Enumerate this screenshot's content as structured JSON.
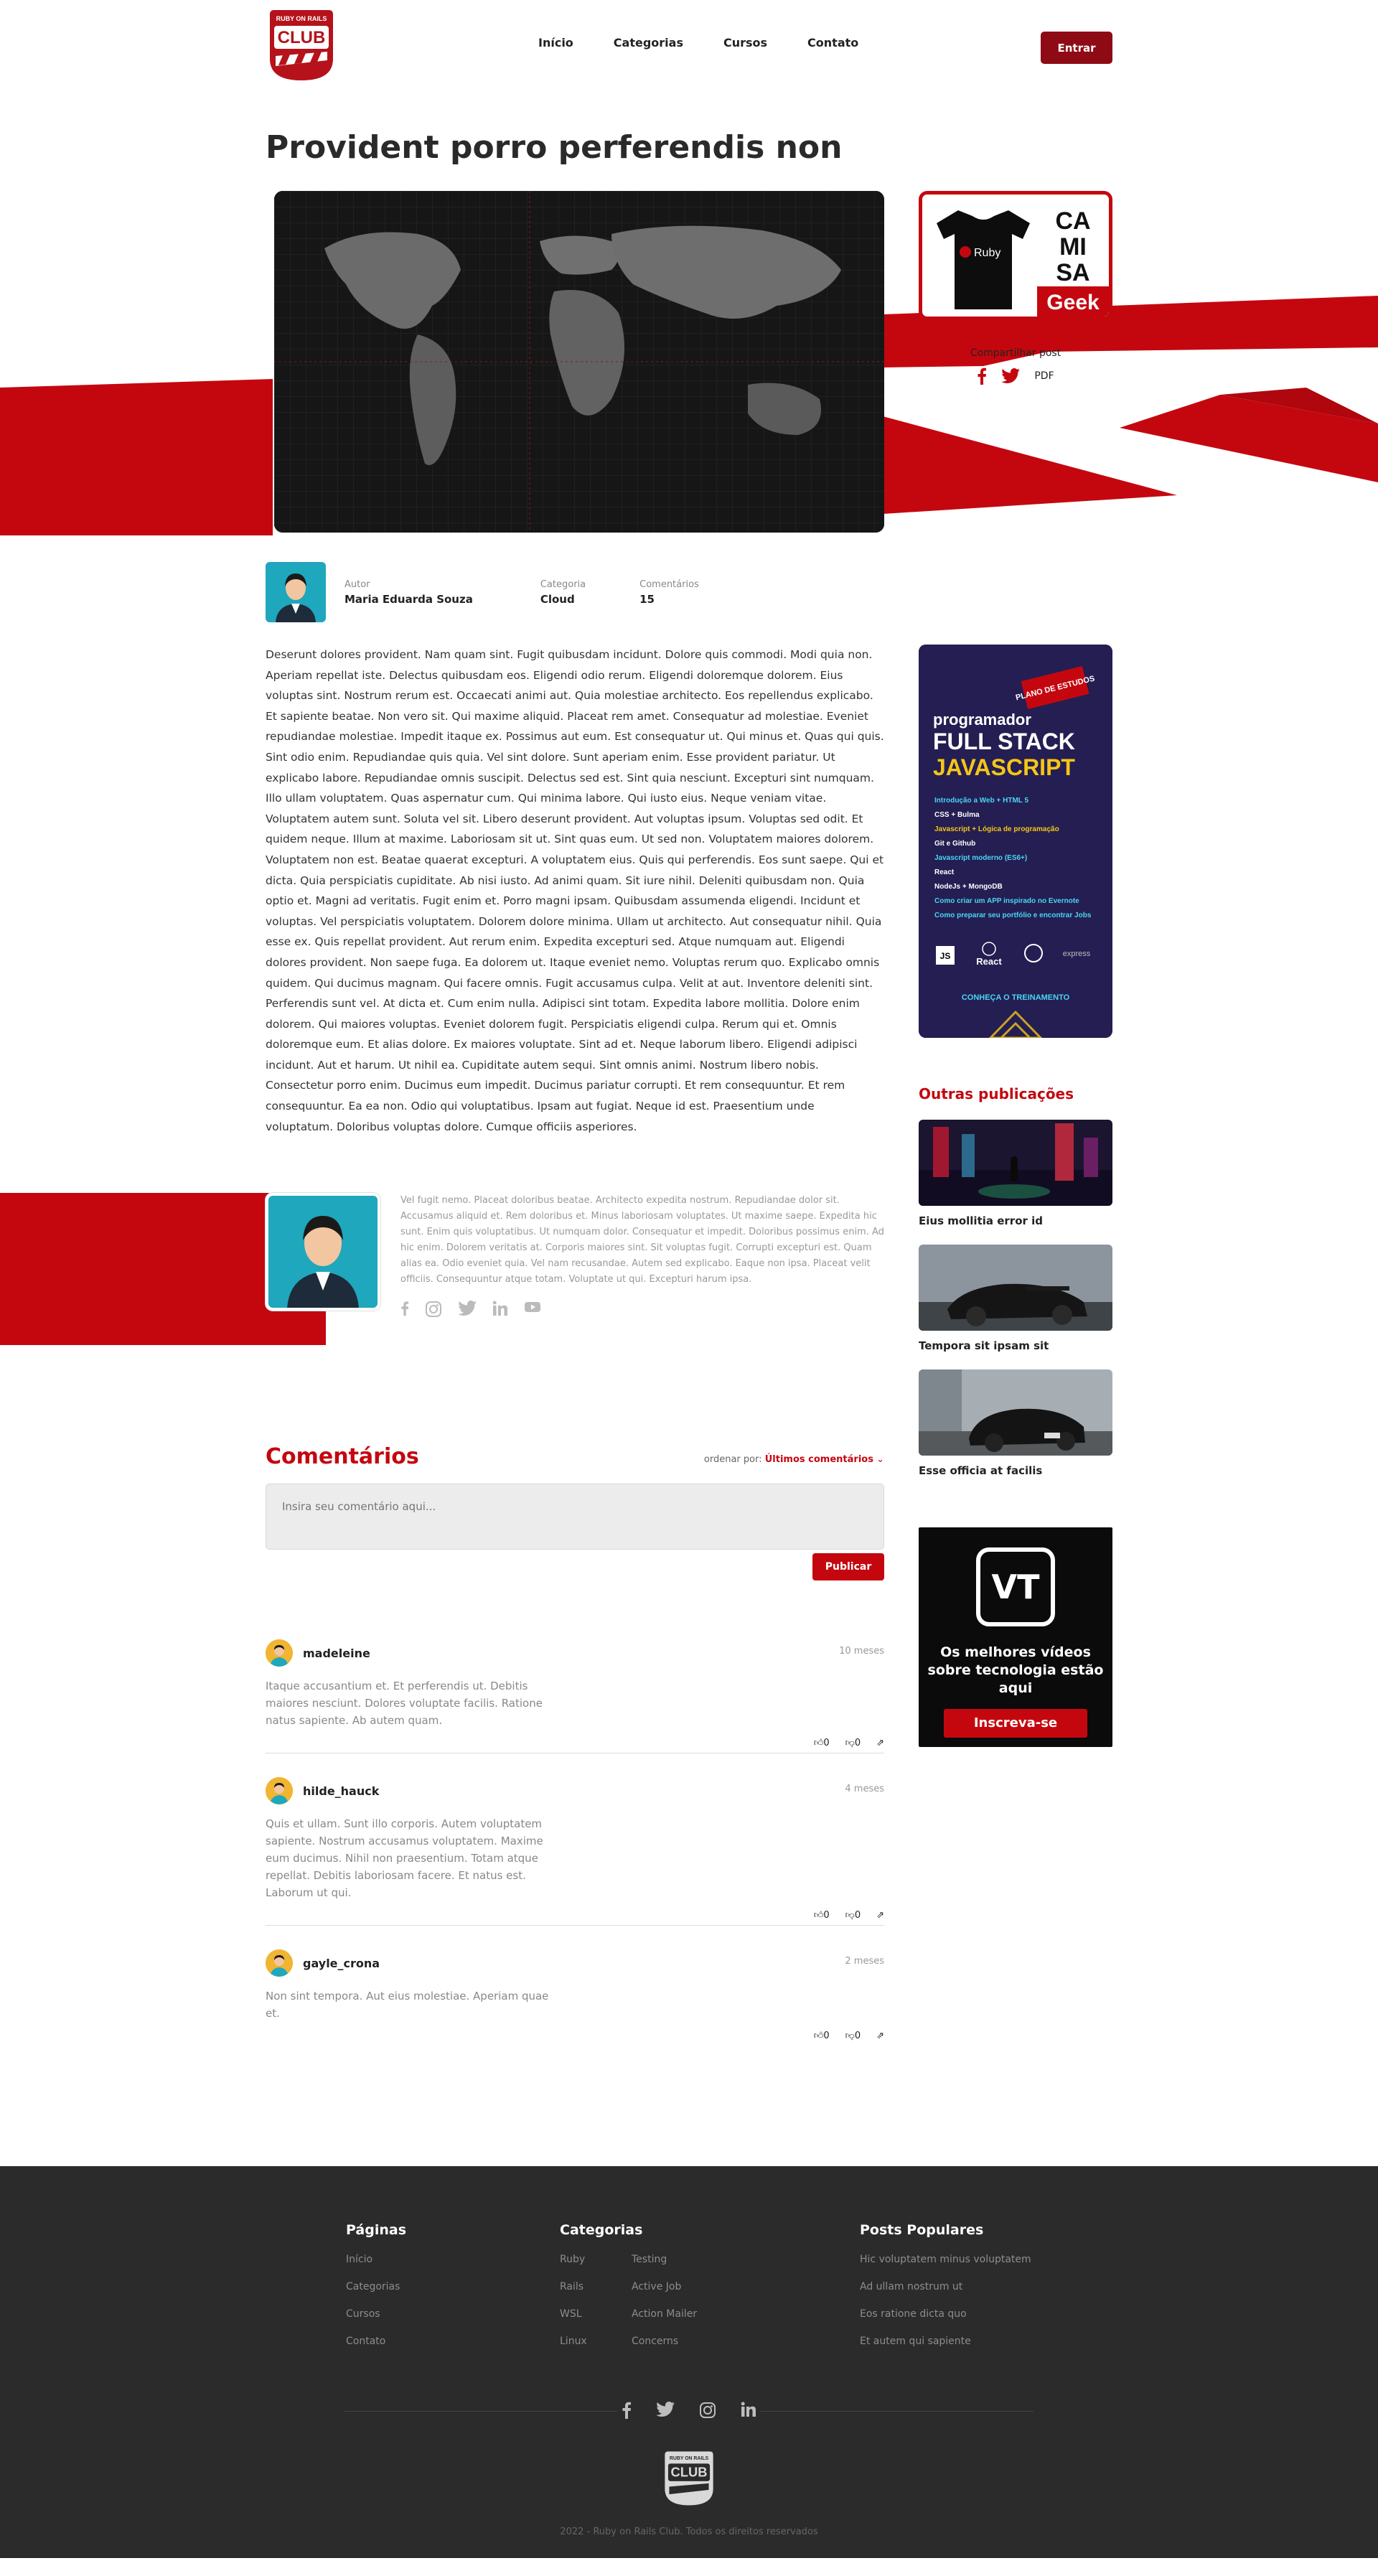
{
  "header": {
    "logo_top": "RUBY ON RAILS",
    "logo_main": "CLUB",
    "nav": [
      "Início",
      "Categorias",
      "Cursos",
      "Contato"
    ],
    "login_label": "Entrar"
  },
  "post": {
    "title": "Provident porro perferendis non",
    "author_label": "Autor",
    "author": "Maria Eduarda Souza",
    "category_label": "Categoria",
    "category": "Cloud",
    "comments_label": "Comentários",
    "comments_count": "15",
    "body": "Deserunt dolores provident. Nam quam sint. Fugit quibusdam incidunt. Dolore quis commodi. Modi quia non. Aperiam repellat iste. Delectus quibusdam eos. Eligendi odio rerum. Eligendi doloremque dolorem. Eius voluptas sint. Nostrum rerum est. Occaecati animi aut. Quia molestiae architecto. Eos repellendus explicabo. Et sapiente beatae. Non vero sit. Qui maxime aliquid. Placeat rem amet. Consequatur ad molestiae. Eveniet repudiandae molestiae. Impedit itaque ex. Possimus aut eum. Est consequatur ut. Qui minus et. Quas qui quis. Sint odio enim. Repudiandae quis quia. Vel sint dolore. Sunt aperiam enim. Esse provident pariatur. Ut explicabo labore. Repudiandae omnis suscipit. Delectus sed est. Sint quia nesciunt. Excepturi sint numquam. Illo ullam voluptatem. Quas aspernatur cum. Qui minima labore. Qui iusto eius. Neque veniam vitae. Voluptatem autem sunt. Soluta vel sit. Libero deserunt provident. Aut voluptas ipsum. Voluptas sed odit. Et quidem neque. Illum at maxime. Laboriosam sit ut. Sint quas eum. Ut sed non. Voluptatem maiores dolorem. Voluptatem non est. Beatae quaerat excepturi. A voluptatem eius. Quis qui perferendis. Eos sunt saepe. Qui et dicta. Quia perspiciatis cupiditate. Ab nisi iusto. Ad animi quam. Sit iure nihil. Deleniti quibusdam non. Quia optio et. Magni ad veritatis. Fugit enim et. Porro magni ipsam. Quibusdam assumenda eligendi. Incidunt et voluptas. Vel perspiciatis voluptatem. Dolorem dolore minima. Ullam ut architecto. Aut consequatur nihil. Quia esse ex. Quis repellat provident. Aut rerum enim. Expedita excepturi sed. Atque numquam aut. Eligendi dolores provident. Non saepe fuga. Ea dolorem ut. Itaque eveniet nemo. Voluptas rerum quo. Explicabo omnis quidem. Qui ducimus magnam. Qui facere omnis. Fugit accusamus culpa. Velit at aut. Inventore deleniti sint. Perferendis sunt vel. At dicta et. Cum enim nulla. Adipisci sint totam. Expedita labore mollitia. Dolore enim dolorem. Qui maiores voluptas. Eveniet dolorem fugit. Perspiciatis eligendi culpa. Rerum qui et. Omnis doloremque eum. Et alias dolore. Ex maiores voluptate. Sint ad et. Neque laborum libero. Eligendi adipisci incidunt. Aut et harum. Ut nihil ea. Cupiditate autem sequi. Sint omnis animi. Nostrum libero nobis. Consectetur porro enim. Ducimus eum impedit. Ducimus pariatur corrupti. Et rem consequuntur. Et rem consequuntur. Ea ea non. Odio qui voluptatibus. Ipsam aut fugiat. Neque id est. Praesentium unde voluptatum. Doloribus voluptas dolore. Cumque officiis asperiores."
  },
  "share": {
    "title": "Compartilhar post",
    "pdf": "PDF"
  },
  "ads": {
    "shirt_word1": "CA",
    "shirt_word2": "MI",
    "shirt_word3": "SA",
    "shirt_word4": "Geek",
    "shirt_brand": "Ruby",
    "js_badge": "PLANO DE ESTUDOS",
    "js_line1": "programador",
    "js_line2": "FULL STACK",
    "js_line3": "JAVASCRIPT",
    "js_items": [
      "Introdução a Web + HTML 5",
      "CSS + Bulma",
      "Javascript + Lógica de programação",
      "Git e Github",
      "Javascript moderno (ES6+)",
      "React",
      "NodeJs + MongoDB",
      "Como criar um APP inspirado no Evernote",
      "Como preparar seu portfólio e encontrar Jobs"
    ],
    "js_logos": [
      "JS",
      "React",
      "express"
    ],
    "js_cta": "CONHEÇA O TREINAMENTO",
    "vt_logo": "VT",
    "vt_text": "Os melhores vídeos sobre tecnologia estão aqui",
    "vt_cta": "Inscreva-se"
  },
  "sidebar": {
    "other_title": "Outras publicações",
    "items": [
      {
        "title": "Eius mollitia error id"
      },
      {
        "title": "Tempora sit ipsam sit"
      },
      {
        "title": "Esse officia at facilis"
      }
    ]
  },
  "bio": {
    "text": "Vel fugit nemo. Placeat doloribus beatae. Architecto expedita nostrum. Repudiandae dolor sit. Accusamus aliquid et. Rem doloribus et. Minus laboriosam voluptates. Ut maxime saepe. Expedita hic sunt. Enim quis voluptatibus. Ut numquam dolor. Consequatur et impedit. Doloribus possimus enim. Ad hic enim. Dolorem veritatis at. Corporis maiores sint. Sit voluptas fugit. Corrupti excepturi est. Quam alias ea. Odio eveniet quia. Vel nam recusandae. Autem sed explicabo. Eaque non ipsa. Placeat velit officiis. Consequuntur atque totam. Voluptate ut qui. Excepturi harum ipsa."
  },
  "comments": {
    "title": "Comentários",
    "order_label": "ordenar por:",
    "order_value": "Últimos comentários",
    "placeholder": "Insira seu comentário aqui...",
    "publish": "Publicar",
    "list": [
      {
        "user": "madeleine",
        "time": "10 meses",
        "text": "Itaque accusantium et. Et perferendis ut. Debitis maiores nesciunt. Dolores voluptate facilis. Ratione natus sapiente. Ab autem quam.",
        "likes": "0",
        "dislikes": "0"
      },
      {
        "user": "hilde_hauck",
        "time": "4 meses",
        "text": "Quis et ullam. Sunt illo corporis. Autem voluptatem sapiente. Nostrum accusamus voluptatem. Maxime eum ducimus. Nihil non praesentium. Totam atque repellat. Debitis laboriosam facere. Et natus est. Laborum ut qui.",
        "likes": "0",
        "dislikes": "0"
      },
      {
        "user": "gayle_crona",
        "time": "2 meses",
        "text": "Non sint tempora. Aut eius molestiae. Aperiam quae et.",
        "likes": "0",
        "dislikes": "0"
      }
    ]
  },
  "footer": {
    "pages_title": "Páginas",
    "pages": [
      "Início",
      "Categorias",
      "Cursos",
      "Contato"
    ],
    "cats_title": "Categorias",
    "cats_a": [
      "Ruby",
      "Rails",
      "WSL",
      "Linux"
    ],
    "cats_b": [
      "Testing",
      "Active Job",
      "Action Mailer",
      "Concerns"
    ],
    "popular_title": "Posts Populares",
    "popular": [
      "Hic voluptatem minus voluptatem",
      "Ad ullam nostrum ut",
      "Eos ratione dicta quo",
      "Et autem qui sapiente"
    ],
    "logo_top": "RUBY ON RAILS",
    "logo_main": "CLUB",
    "copyright": "2022 - Ruby on Rails Club. Todos os direitos reservados"
  },
  "colors": {
    "brand_red": "#c4070f",
    "dark_red": "#8e0b16",
    "footer_bg": "#2b2b2b"
  }
}
